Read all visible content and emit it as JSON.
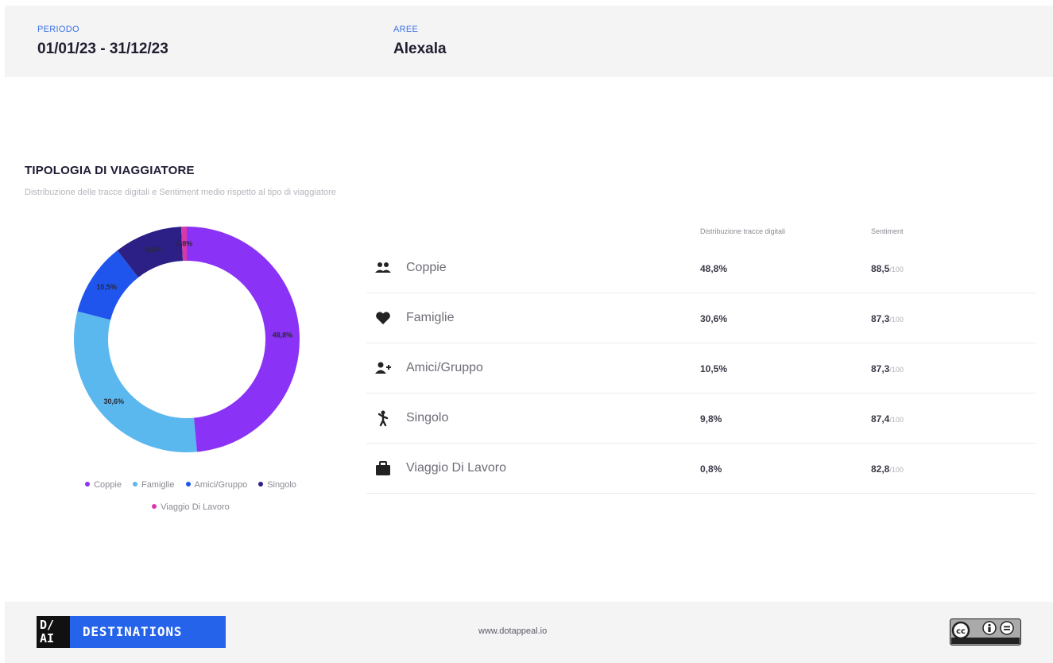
{
  "header": {
    "period_label": "PERIODO",
    "period_value": "01/01/23 - 31/12/23",
    "area_label": "AREE",
    "area_value": "Alexala"
  },
  "section": {
    "title": "TIPOLOGIA DI VIAGGIATORE",
    "subtitle": "Distribuzione delle tracce digitali e Sentiment medio rispetto al tipo di viaggiatore"
  },
  "table": {
    "headers": {
      "distribution": "Distribuzione tracce digitali",
      "sentiment": "Sentiment"
    },
    "rows": [
      {
        "icon": "couple-icon",
        "label": "Coppie",
        "pct": "48,8%",
        "score": "88,5",
        "max": "/100"
      },
      {
        "icon": "heart-icon",
        "label": "Famiglie",
        "pct": "30,6%",
        "score": "87,3",
        "max": "/100"
      },
      {
        "icon": "group-icon",
        "label": "Amici/Gruppo",
        "pct": "10,5%",
        "score": "87,3",
        "max": "/100"
      },
      {
        "icon": "solo-traveler-icon",
        "label": "Singolo",
        "pct": "9,8%",
        "score": "87,4",
        "max": "/100"
      },
      {
        "icon": "briefcase-icon",
        "label": "Viaggio Di Lavoro",
        "pct": "0,8%",
        "score": "82,8",
        "max": "/100"
      }
    ]
  },
  "chart_data": {
    "type": "pie",
    "donut": true,
    "legend_position": "bottom",
    "categories": [
      "Coppie",
      "Famiglie",
      "Amici/Gruppo",
      "Singolo",
      "Viaggio Di Lavoro"
    ],
    "values": [
      48.8,
      30.6,
      10.5,
      9.8,
      0.8
    ],
    "data_labels": [
      "48,8%",
      "30,6%",
      "10,5%",
      "9,8%",
      "0,8%"
    ],
    "colors": [
      "#8a32f5",
      "#5ab8ee",
      "#1f55ec",
      "#2c1f85",
      "#d63aa8"
    ]
  },
  "footer": {
    "logo_mark": "D/\nAI",
    "logo_text": "DESTINATIONS",
    "url": "www.dotappeal.io",
    "license_icon": "cc-by-nd-icon"
  }
}
